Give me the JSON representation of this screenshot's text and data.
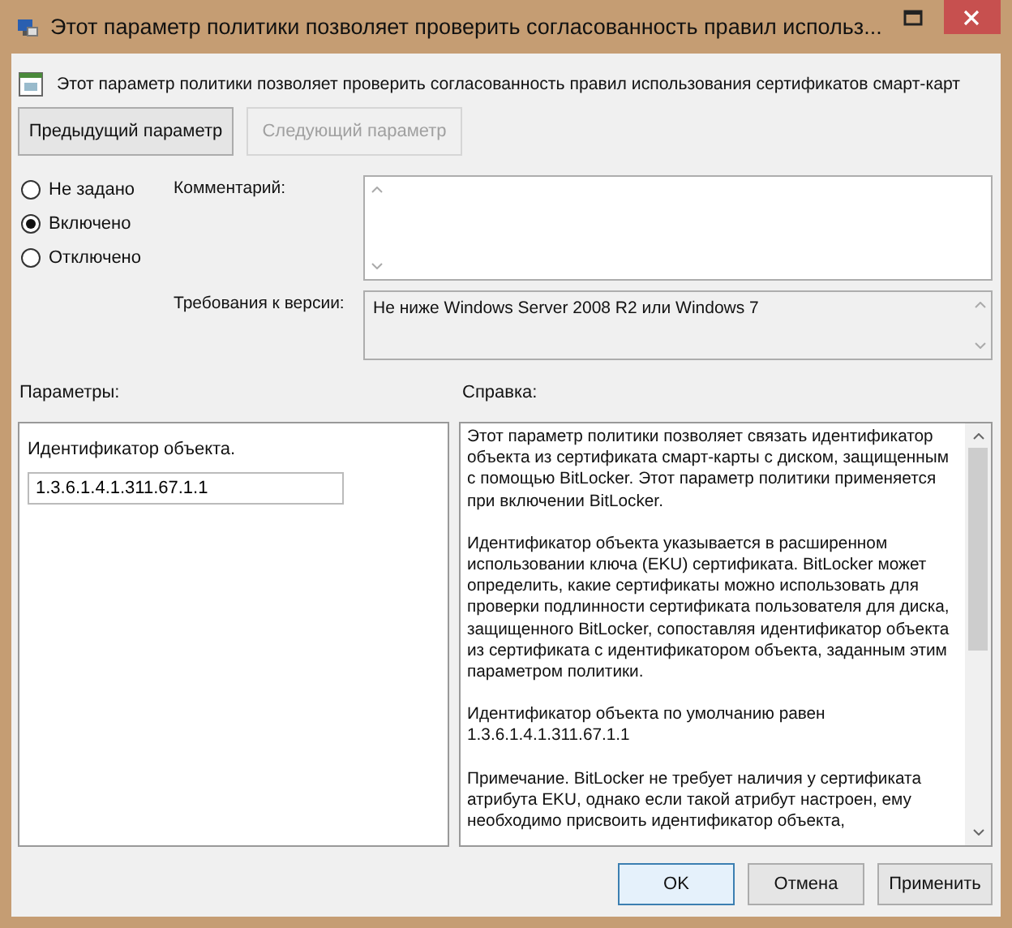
{
  "window": {
    "title": "Этот параметр политики позволяет проверить согласованность правил использ..."
  },
  "header": {
    "text": "Этот параметр политики позволяет проверить согласованность правил использования сертификатов смарт-карт"
  },
  "nav_buttons": [
    {
      "label": "Предыдущий параметр",
      "disabled": false
    },
    {
      "label": "Следующий параметр",
      "disabled": true
    }
  ],
  "options": [
    {
      "label": "Не задано",
      "selected": false
    },
    {
      "label": "Включено",
      "selected": true
    },
    {
      "label": "Отключено",
      "selected": false
    }
  ],
  "comment": {
    "label": "Комментарий:"
  },
  "version": {
    "label": "Требования к версии:",
    "value": "Не ниже Windows Server 2008 R2 или Windows 7"
  },
  "parameters": {
    "label": "Параметры:",
    "field_label": "Идентификатор объекта.",
    "value": "1.3.6.1.4.1.311.67.1.1"
  },
  "help": {
    "label": "Справка:",
    "paragraphs": [
      "Этот параметр политики позволяет связать идентификатор объекта из сертификата смарт-карты с диском, защищенным с помощью BitLocker. Этот параметр политики применяется при включении BitLocker.",
      "Идентификатор объекта указывается в расширенном использовании ключа (EKU) сертификата.  BitLocker может определить, какие сертификаты можно использовать для проверки подлинности сертификата пользователя для диска, защищенного BitLocker, сопоставляя идентификатор объекта из сертификата с идентификатором объекта, заданным этим параметром политики.",
      "Идентификатор объекта по умолчанию равен 1.3.6.1.4.1.311.67.1.1",
      "Примечание. BitLocker не требует наличия у сертификата атрибута EKU, однако если такой атрибут настроен, ему необходимо присвоить идентификатор объекта,"
    ]
  },
  "buttons": [
    {
      "label": "OK",
      "default": true
    },
    {
      "label": "Отмена",
      "default": false
    },
    {
      "label": "Применить",
      "default": false
    }
  ]
}
